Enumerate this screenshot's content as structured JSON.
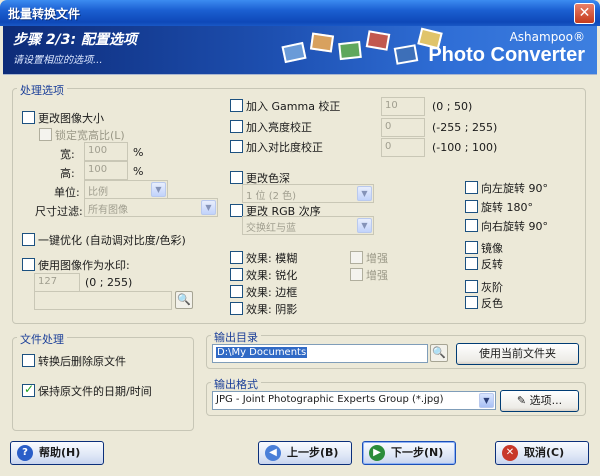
{
  "window": {
    "title": "批量转换文件",
    "close_icon": "✕"
  },
  "banner": {
    "step": "步骤 2/3: 配置选项",
    "subtitle": "请设置相应的选项...",
    "brand_small": "Ashampoo®",
    "brand_large": "Photo Converter"
  },
  "processing": {
    "group_label": "处理选项",
    "resize": {
      "label": "更改图像大小",
      "keep_ratio": "锁定宽高比(L)",
      "width_label": "宽:",
      "width_value": "100",
      "width_unit": "%",
      "height_label": "高:",
      "height_value": "100",
      "height_unit": "%",
      "unit_label": "单位:",
      "unit_value": "比例",
      "filter_label": "尺寸过滤:",
      "filter_value": "所有图像"
    },
    "auto_optimize": "一键优化 (自动调对比度/色彩)",
    "watermark": {
      "label": "使用图像作为水印:",
      "value": "127",
      "range": "(0 ; 255)",
      "path": ""
    },
    "gamma": {
      "label": "加入 Gamma 校正",
      "value": "10",
      "range": "(0 ; 50)"
    },
    "brightness": {
      "label": "加入亮度校正",
      "value": "0",
      "range": "(-255 ; 255)"
    },
    "contrast": {
      "label": "加入对比度校正",
      "value": "0",
      "range": "(-100 ; 100)"
    },
    "color_depth": {
      "label": "更改色深",
      "value": "1 位 (2 色)"
    },
    "rgb_order": {
      "label": "更改 RGB 次序",
      "value": "交换红与蓝"
    },
    "effects": [
      {
        "label": "效果: 模糊",
        "enhance": "增强"
      },
      {
        "label": "效果: 锐化",
        "enhance": "增强"
      },
      {
        "label": "效果: 边框"
      },
      {
        "label": "效果: 阴影"
      }
    ],
    "rotate": [
      "向左旋转 90°",
      "旋转 180°",
      "向右旋转 90°"
    ],
    "transform": [
      "镜像",
      "反转"
    ],
    "color": [
      "灰阶",
      "反色"
    ]
  },
  "file_handling": {
    "group_label": "文件处理",
    "delete_original": "转换后删除原文件",
    "keep_date": "保持原文件的日期/时间"
  },
  "output_dir": {
    "group_label": "输出目录",
    "value": "D:\\My Documents",
    "use_current": "使用当前文件夹"
  },
  "output_format": {
    "group_label": "输出格式",
    "value": "JPG - Joint Photographic Experts Group (*.jpg)",
    "options_button": "选项..."
  },
  "footer": {
    "help": "帮助(H)",
    "back": "上一步(B)",
    "next": "下一步(N)",
    "cancel": "取消(C)"
  }
}
